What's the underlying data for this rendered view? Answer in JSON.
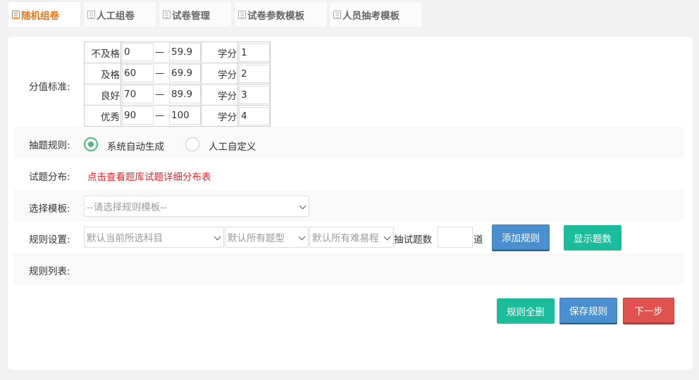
{
  "tabs": [
    {
      "label": "随机组卷",
      "active": true
    },
    {
      "label": "人工组卷",
      "active": false
    },
    {
      "label": "试卷管理",
      "active": false
    },
    {
      "label": "试卷参数模板",
      "active": false
    },
    {
      "label": "人员抽考模板",
      "active": false
    }
  ],
  "form": {
    "score_label": "分值标准:",
    "score_rows": [
      {
        "name": "不及格",
        "from": "0",
        "to": "59.9",
        "credit_label": "学分",
        "credit": "1"
      },
      {
        "name": "及格",
        "from": "60",
        "to": "69.9",
        "credit_label": "学分",
        "credit": "2"
      },
      {
        "name": "良好",
        "from": "70",
        "to": "89.9",
        "credit_label": "学分",
        "credit": "3"
      },
      {
        "name": "优秀",
        "from": "90",
        "to": "100",
        "credit_label": "学分",
        "credit": "4"
      }
    ],
    "range_dash": "—",
    "rule_label": "抽题规则:",
    "rule_options": [
      "系统自动生成",
      "人工自定义"
    ],
    "rule_selected": "系统自动生成",
    "distribution_label": "试题分布:",
    "distribution_link": "点击查看题库试题详细分布表",
    "template_label": "选择模板:",
    "template_select": "--请选择规则模板--",
    "settings_label": "规则设置:",
    "subject_select": "默认当前所选科目",
    "type_select": "默认所有题型",
    "difficulty_select": "默认所有难易程",
    "count_label": "抽试题数",
    "count_value": "",
    "count_unit": "道",
    "add_rule_button": "添加规则",
    "show_count_button": "显示题数",
    "rule_list_label": "规则列表:"
  },
  "actions": {
    "delete_all": "规则全删",
    "save_rule": "保存规则",
    "next_step": "下一步"
  },
  "colors": {
    "active_tab": "#e8741c",
    "green": "#1bbc9b",
    "blue": "#4a90d0",
    "red": "#e0524f",
    "link_red": "#e5262a",
    "radio_green": "#4cbb7f"
  }
}
